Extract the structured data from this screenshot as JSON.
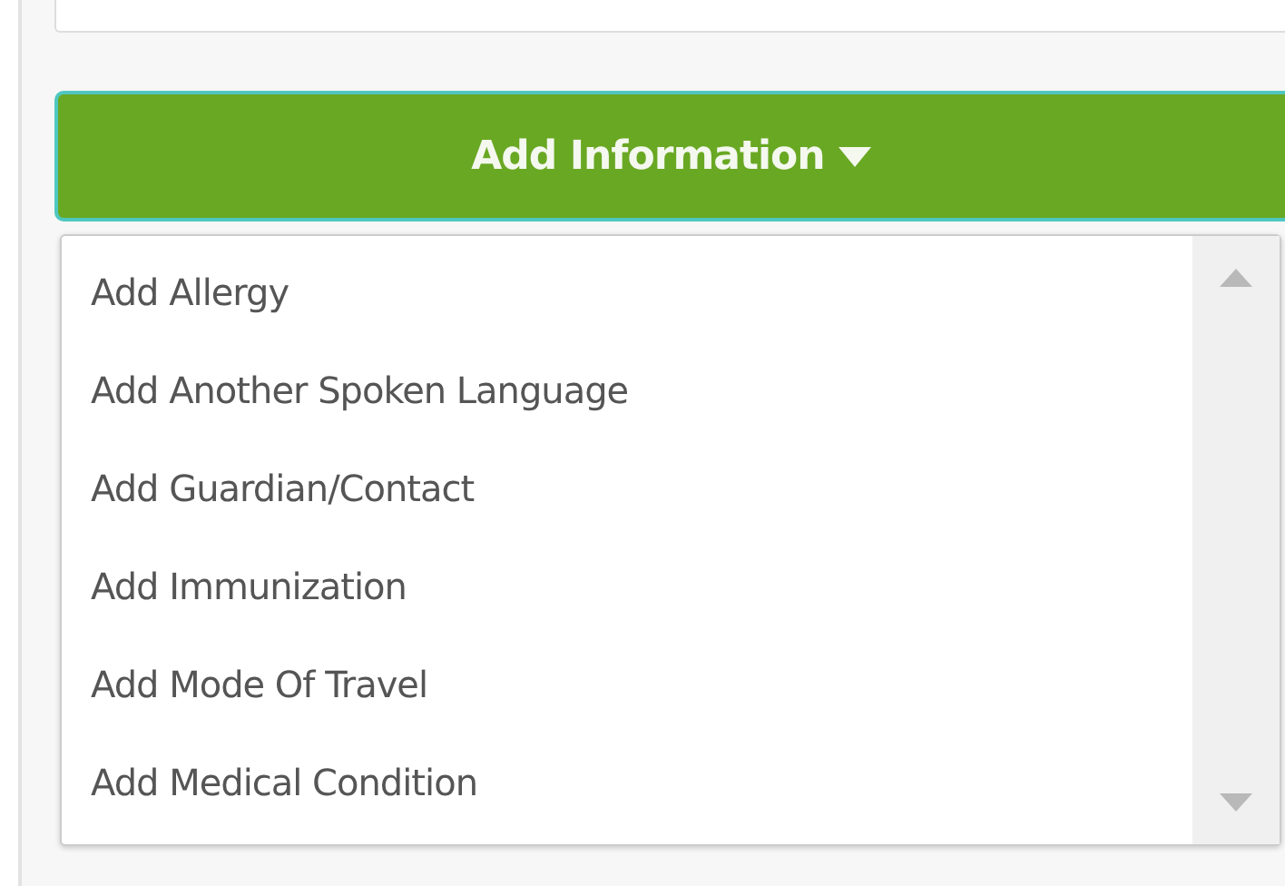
{
  "button": {
    "label": "Add Information"
  },
  "menu": {
    "items": [
      {
        "label": "Add Allergy"
      },
      {
        "label": "Add Another Spoken Language"
      },
      {
        "label": "Add Guardian/Contact"
      },
      {
        "label": "Add Immunization"
      },
      {
        "label": "Add Mode Of Travel"
      },
      {
        "label": "Add Medical Condition"
      }
    ]
  }
}
